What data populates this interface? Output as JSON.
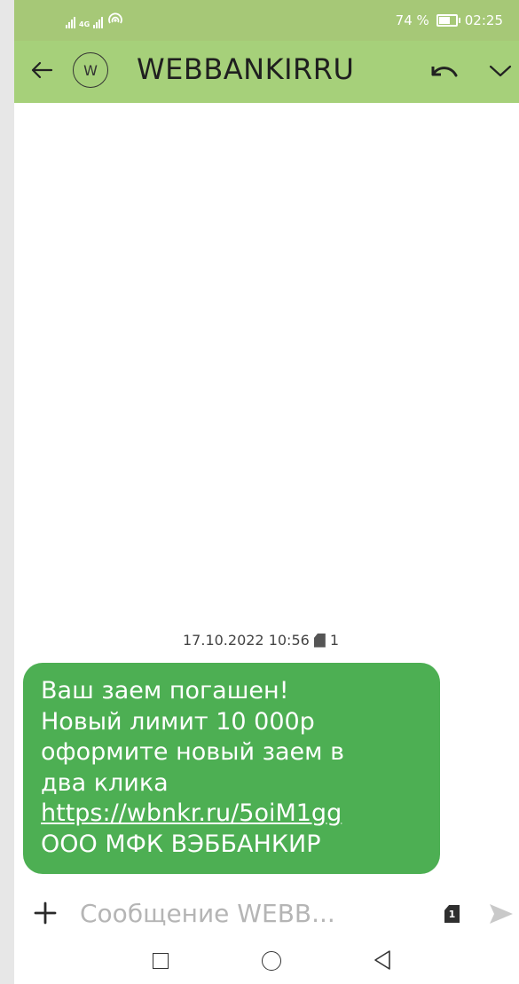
{
  "status_bar": {
    "network": "4G",
    "battery_percent_label": "74 %",
    "battery_level": 0.74,
    "time": "02:25"
  },
  "header": {
    "avatar_letter": "W",
    "title": "WEBBANKIRRU",
    "icons": [
      "back-arrow-icon",
      "reply-icon",
      "chevron-down-icon"
    ]
  },
  "thread": {
    "timestamp": "17.10.2022 10:56",
    "sim_slot": "1",
    "message_lines": [
      "Ваш заем погашен!",
      "Новый лимит 10 000р",
      "оформите новый заем в",
      "два клика",
      "https://wbnkr.ru/5oiM1gg",
      "ООО МФК ВЭББАНКИР"
    ],
    "bubble_color": "#4daf53"
  },
  "composer": {
    "placeholder": "Сообщение WEBB...",
    "sim_slot": "1",
    "icons": [
      "plus-icon",
      "sim-icon",
      "send-icon"
    ]
  },
  "colors": {
    "status_bar": "#a6c877",
    "header": "#a6d07a",
    "background": "#ffffff"
  }
}
